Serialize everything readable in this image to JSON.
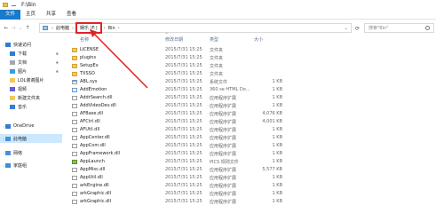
{
  "window": {
    "title": "F:\\Bin"
  },
  "ribbon": {
    "tabs": [
      "文件",
      "主页",
      "共享",
      "查看"
    ]
  },
  "nav": {
    "back": "←",
    "forward": "→",
    "up": "↑",
    "recent": "⌄",
    "refresh": "⟳"
  },
  "address": {
    "crumbs": [
      "此电脑",
      "娱乐 (F:)",
      "Bin"
    ],
    "separator": "›",
    "dropdown": "⌄"
  },
  "search": {
    "placeholder": "搜索\"Bin\""
  },
  "sidebar": {
    "items": [
      {
        "label": "快速访问",
        "icon": "star-icon",
        "color": "#2f7cd6",
        "indent": 0
      },
      {
        "label": "下载",
        "icon": "download-icon",
        "color": "#2f7cd6",
        "indent": 1,
        "pinned": true
      },
      {
        "label": "文档",
        "icon": "document-icon",
        "color": "#a0a8b4",
        "indent": 1,
        "pinned": true
      },
      {
        "label": "图片",
        "icon": "picture-icon",
        "color": "#3b9be0",
        "indent": 1,
        "pinned": true
      },
      {
        "label": "LOL谢谢图片",
        "icon": "folder-icon",
        "color": "#f5c85a",
        "indent": 1
      },
      {
        "label": "视频",
        "icon": "video-icon",
        "color": "#6b5ccf",
        "indent": 1
      },
      {
        "label": "新建文件夹",
        "icon": "folder-icon",
        "color": "#f5c85a",
        "indent": 1
      },
      {
        "label": "音乐",
        "icon": "music-icon",
        "color": "#3b7bd1",
        "indent": 1
      },
      {
        "label": "OneDrive",
        "icon": "cloud-icon",
        "color": "#2f7cd6",
        "indent": 0
      },
      {
        "label": "此电脑",
        "icon": "computer-icon",
        "color": "#4a90d9",
        "indent": 0,
        "selected": true
      },
      {
        "label": "网络",
        "icon": "network-icon",
        "color": "#4a90d9",
        "indent": 0
      },
      {
        "label": "家庭组",
        "icon": "homegroup-icon",
        "color": "#3a8fd6",
        "indent": 0
      }
    ]
  },
  "columns": {
    "name": "名称",
    "date": "修改日期",
    "type": "类型",
    "size": "大小",
    "sort_indicator": "^"
  },
  "files": [
    {
      "name": "LICENSE",
      "date": "2015/7/31 15:25",
      "type": "文件夹",
      "size": "",
      "kind": "folder"
    },
    {
      "name": "plugins",
      "date": "2015/7/31 15:25",
      "type": "文件夹",
      "size": "",
      "kind": "folder"
    },
    {
      "name": "SetupEx",
      "date": "2015/7/31 15:25",
      "type": "文件夹",
      "size": "",
      "kind": "folder"
    },
    {
      "name": "TXSSO",
      "date": "2015/7/31 15:25",
      "type": "文件夹",
      "size": "",
      "kind": "folder"
    },
    {
      "name": "ABL.sys",
      "date": "2015/7/31 15:25",
      "type": "系统文件",
      "size": "1 KB",
      "kind": "log"
    },
    {
      "name": "AddEmotion",
      "date": "2015/7/31 15:25",
      "type": "360 se HTML Do...",
      "size": "1 KB",
      "kind": "html"
    },
    {
      "name": "AddrSearch.dll",
      "date": "2015/7/31 15:25",
      "type": "应用程序扩展",
      "size": "1 KB",
      "kind": "dll"
    },
    {
      "name": "AddVideoDev.dll",
      "date": "2015/7/31 15:25",
      "type": "应用程序扩展",
      "size": "1 KB",
      "kind": "dll"
    },
    {
      "name": "AFBase.dll",
      "date": "2015/7/31 15:25",
      "type": "应用程序扩展",
      "size": "4,076 KB",
      "kind": "dll"
    },
    {
      "name": "AFCtrl.dll",
      "date": "2015/7/31 15:25",
      "type": "应用程序扩展",
      "size": "4,001 KB",
      "kind": "dll"
    },
    {
      "name": "AFUtil.dll",
      "date": "2015/7/31 15:25",
      "type": "应用程序扩展",
      "size": "1 KB",
      "kind": "dll"
    },
    {
      "name": "AppCenter.dll",
      "date": "2015/7/31 15:25",
      "type": "应用程序扩展",
      "size": "1 KB",
      "kind": "dll"
    },
    {
      "name": "AppCom.dll",
      "date": "2015/7/31 15:25",
      "type": "应用程序扩展",
      "size": "1 KB",
      "kind": "dll"
    },
    {
      "name": "AppFramework.dll",
      "date": "2015/7/31 15:25",
      "type": "应用程序扩展",
      "size": "1 KB",
      "kind": "dll"
    },
    {
      "name": "AppLaunch",
      "date": "2015/7/31 15:25",
      "type": "PICS 规则文件",
      "size": "1 KB",
      "kind": "pics"
    },
    {
      "name": "AppMisc.dll",
      "date": "2015/7/31 15:25",
      "type": "应用程序扩展",
      "size": "5,577 KB",
      "kind": "dll"
    },
    {
      "name": "AppUtil.dll",
      "date": "2015/7/31 15:25",
      "type": "应用程序扩展",
      "size": "1 KB",
      "kind": "dll"
    },
    {
      "name": "arkEngine.dll",
      "date": "2015/7/31 15:25",
      "type": "应用程序扩展",
      "size": "1 KB",
      "kind": "dll"
    },
    {
      "name": "arkGraphic.dll",
      "date": "2015/7/31 15:25",
      "type": "应用程序扩展",
      "size": "1 KB",
      "kind": "dll"
    },
    {
      "name": "arkGraphic.dll",
      "date": "2015/7/31 15:25",
      "type": "应用程序扩展",
      "size": "1 KB",
      "kind": "dll"
    }
  ],
  "colors": {
    "accent": "#1979ca",
    "selection": "#cce8ff",
    "annotation": "#e02424"
  }
}
